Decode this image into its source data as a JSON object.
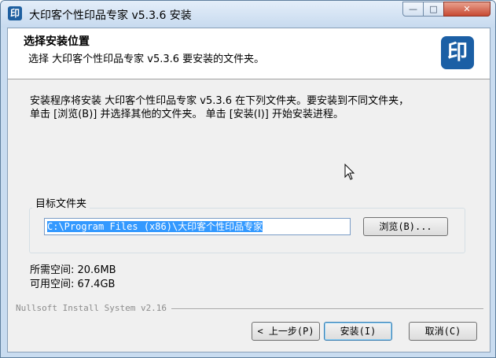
{
  "window": {
    "title": "大印客个性印品专家 v5.3.6 安装",
    "app_icon": "印",
    "caption": {
      "minimize": "—",
      "maximize": "□",
      "close": "✕"
    }
  },
  "header": {
    "title": "选择安装位置",
    "subtitle": "选择 大印客个性印品专家 v5.3.6 要安装的文件夹。",
    "logo": "印"
  },
  "intro": {
    "line1": "安装程序将安装 大印客个性印品专家 v5.3.6 在下列文件夹。要安装到不同文件夹，",
    "line2": "单击 [浏览(B)] 并选择其他的文件夹。 单击 [安装(I)] 开始安装进程。"
  },
  "destination": {
    "label": "目标文件夹",
    "path": "C:\\Program Files (x86)\\大印客个性印品专家",
    "browse_label": "浏览(B)..."
  },
  "space": {
    "required": "所需空间: 20.6MB",
    "available": "可用空间: 67.4GB"
  },
  "branding": "Nullsoft Install System v2.16",
  "buttons": {
    "back": "< 上一步(P)",
    "install": "安装(I)",
    "cancel": "取消(C)"
  }
}
